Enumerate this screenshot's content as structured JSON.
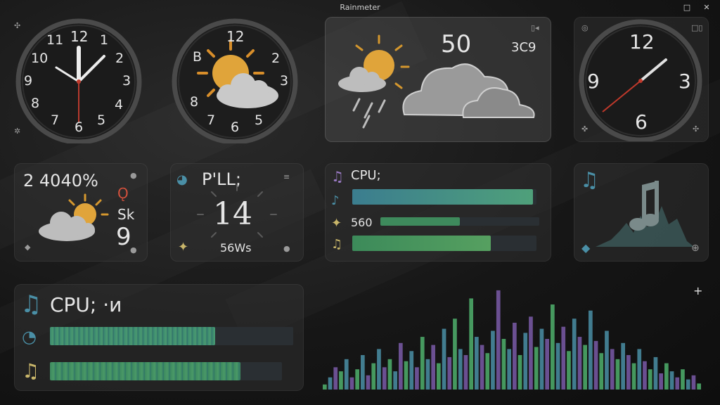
{
  "window": {
    "title": "Rainmeter",
    "restore_label": "□",
    "close_label": "✕"
  },
  "clock1": {
    "numbers": [
      "12",
      "1",
      "2",
      "3",
      "4",
      "5",
      "6",
      "7",
      "8",
      "9",
      "10",
      "11"
    ]
  },
  "clock2": {
    "numbers": [
      "12",
      "2",
      "3",
      "5",
      "6",
      "7",
      "8",
      "B"
    ]
  },
  "weather_top": {
    "temp": "50",
    "unit": "3C9",
    "corner": "▯◂"
  },
  "clock3": {
    "numbers": [
      "12",
      "3",
      "6",
      "9"
    ],
    "corner": "□▯"
  },
  "weather_small": {
    "top": "2 4040%",
    "mid": "Sk",
    "big": "9"
  },
  "sys_widget": {
    "title": "P'LL;",
    "big": "14",
    "small": "56Ws"
  },
  "cpu_small": {
    "title": "CPU;",
    "value": "560",
    "bars": [
      0.98,
      0.5,
      0.75
    ]
  },
  "cpu_large": {
    "title": "CPU; ·и",
    "bars": [
      0.68,
      0.82
    ]
  },
  "audio": {
    "plus": "+",
    "levels": [
      0.05,
      0.12,
      0.22,
      0.18,
      0.3,
      0.12,
      0.2,
      0.34,
      0.14,
      0.26,
      0.4,
      0.22,
      0.3,
      0.18,
      0.46,
      0.28,
      0.38,
      0.22,
      0.52,
      0.3,
      0.44,
      0.26,
      0.6,
      0.32,
      0.7,
      0.4,
      0.34,
      0.9,
      0.52,
      0.44,
      0.36,
      0.58,
      0.98,
      0.5,
      0.4,
      0.66,
      0.34,
      0.56,
      0.72,
      0.42,
      0.6,
      0.5,
      0.84,
      0.46,
      0.62,
      0.38,
      0.7,
      0.52,
      0.44,
      0.78,
      0.48,
      0.36,
      0.58,
      0.4,
      0.3,
      0.46,
      0.34,
      0.26,
      0.4,
      0.28,
      0.2,
      0.32,
      0.16,
      0.26,
      0.18,
      0.12,
      0.2,
      0.1,
      0.14,
      0.06
    ]
  },
  "colors": {
    "accent_green": "#4fb06c",
    "accent_teal": "#4a8fa6",
    "accent_purple": "#7a5aa8",
    "hand_red": "#c0392b",
    "sun": "#e0a43a"
  }
}
